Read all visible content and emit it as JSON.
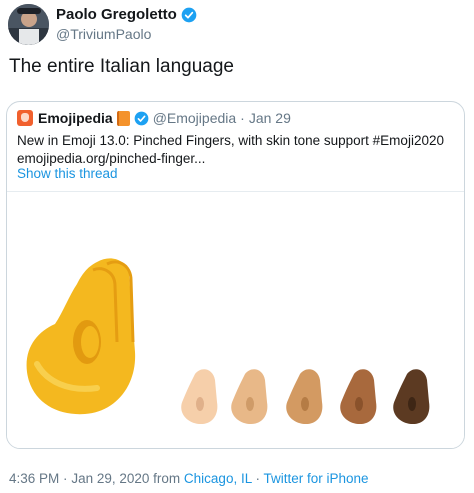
{
  "author": {
    "name": "Paolo Gregoletto",
    "handle": "@TriviumPaolo"
  },
  "tweet": {
    "text": "The entire Italian language"
  },
  "quoted": {
    "name": "Emojipedia",
    "handle": "@Emojipedia",
    "separator": "·",
    "date": "Jan 29",
    "text_line1": "New in Emoji 13.0: Pinched Fingers, with skin tone support #Emoji2020",
    "text_line2": "emojipedia.org/pinched-finger...",
    "show_thread": "Show this thread"
  },
  "media": {
    "skin_tones": [
      "#f6cfaa",
      "#e8b888",
      "#d39a62",
      "#a8693d",
      "#5c3a22"
    ],
    "main_color": "#f4b81f"
  },
  "footer": {
    "time": "4:36 PM",
    "sep1": "·",
    "date": "Jan 29, 2020",
    "from": "from",
    "location": "Chicago, IL",
    "sep2": "·",
    "source": "Twitter for iPhone"
  },
  "colors": {
    "link": "#1b95e0",
    "muted": "#657786",
    "verified": "#1da1f2"
  }
}
